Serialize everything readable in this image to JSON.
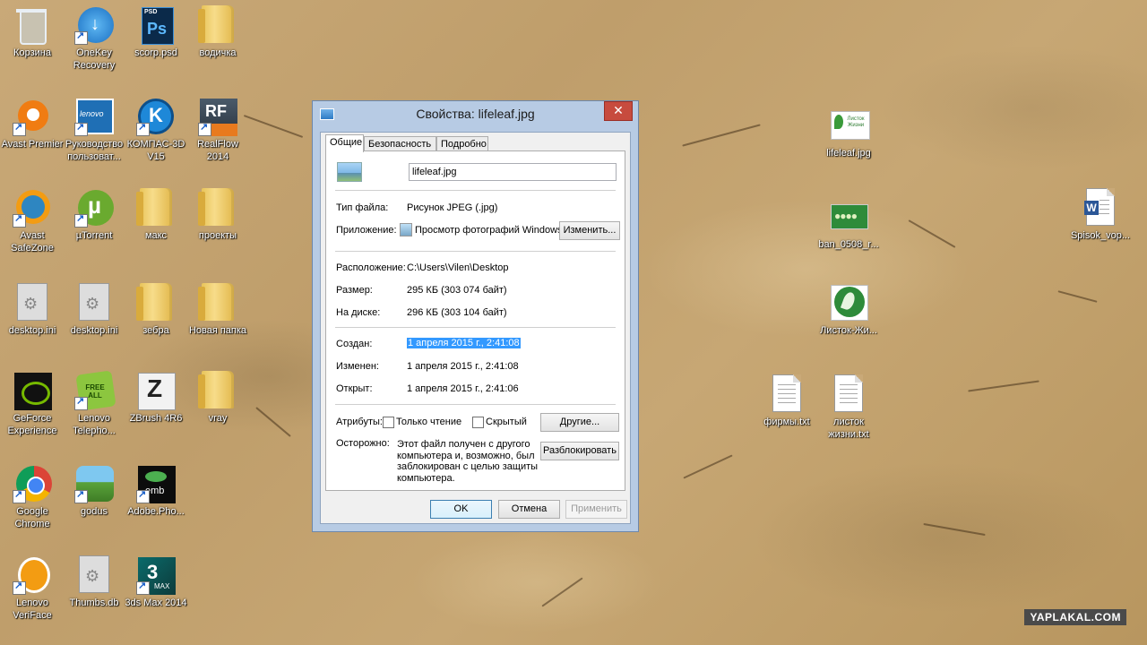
{
  "desktop": {
    "icons": [
      {
        "label": "Корзина",
        "icon": "recycle-bin-icon"
      },
      {
        "label": "OneKey Recovery",
        "icon": "onekey-recovery-icon"
      },
      {
        "label": "scorp.psd",
        "icon": "photoshop-file-icon",
        "badge": "PSD"
      },
      {
        "label": "водичка",
        "icon": "folder-icon"
      },
      {
        "label": "Avast Premier",
        "icon": "avast-icon"
      },
      {
        "label": "Руководство пользоват...",
        "icon": "lenovo-manual-icon",
        "badge": "lenovo"
      },
      {
        "label": "КОМПАС-3D V15",
        "icon": "kompas-icon"
      },
      {
        "label": "RealFlow 2014",
        "icon": "realflow-icon",
        "badge": "RF"
      },
      {
        "label": "Avast SafeZone",
        "icon": "avast-safezone-icon"
      },
      {
        "label": "µTorrent",
        "icon": "utorrent-icon"
      },
      {
        "label": "макс",
        "icon": "folder-icon"
      },
      {
        "label": "проекты",
        "icon": "folder-icon"
      },
      {
        "label": "desktop.ini",
        "icon": "settings-file-icon"
      },
      {
        "label": "desktop.ini",
        "icon": "settings-file-icon"
      },
      {
        "label": "зебра",
        "icon": "folder-icon"
      },
      {
        "label": "Новая папка",
        "icon": "folder-icon"
      },
      {
        "label": "GeForce Experience",
        "icon": "geforce-icon"
      },
      {
        "label": "Lenovo Telepho...",
        "icon": "lenovo-telephony-icon",
        "badge": "FREE ALL"
      },
      {
        "label": "ZBrush 4R6",
        "icon": "zbrush-icon"
      },
      {
        "label": "vray",
        "icon": "folder-icon"
      },
      {
        "label": "Google Chrome",
        "icon": "chrome-icon"
      },
      {
        "label": "godus",
        "icon": "godus-icon"
      },
      {
        "label": "Adobe.Pho...",
        "icon": "adobe-photoshop-icon",
        "badge": "emb"
      },
      {
        "label": "Lenovo VeriFace",
        "icon": "veriface-icon"
      },
      {
        "label": "Thumbs.db",
        "icon": "settings-file-icon"
      },
      {
        "label": "3ds Max 2014",
        "icon": "3dsmax-icon",
        "badge": "MAX"
      },
      {
        "label": "lifeleaf.jpg",
        "icon": "image-file-icon",
        "badge": "Листок Жизни"
      },
      {
        "label": "ban_0508_r...",
        "icon": "image-file-icon"
      },
      {
        "label": "Листок-Жи...",
        "icon": "image-file-icon"
      },
      {
        "label": "фирмы.txt",
        "icon": "text-file-icon"
      },
      {
        "label": "листок жизни.txt",
        "icon": "text-file-icon"
      },
      {
        "label": "Spisok_vop...",
        "icon": "word-file-icon",
        "badge": "W"
      }
    ]
  },
  "dialog": {
    "title": "Свойства: lifeleaf.jpg",
    "close_glyph": "✕",
    "tabs": [
      "Общие",
      "Безопасность",
      "Подробно"
    ],
    "active_tab": "Общие",
    "file_name": "lifeleaf.jpg",
    "type_label": "Тип файла:",
    "type_value": "Рисунок JPEG (.jpg)",
    "app_label": "Приложение:",
    "app_value": "Просмотр фотографий Windows",
    "change_button": "Изменить...",
    "location_label": "Расположение:",
    "location_value": "C:\\Users\\Vilen\\Desktop",
    "size_label": "Размер:",
    "size_value": "295 КБ (303 074 байт)",
    "disk_label": "На диске:",
    "disk_value": "296 КБ (303 104 байт)",
    "created_label": "Создан:",
    "created_value": "1 апреля 2015 г., 2:41:08",
    "modified_label": "Изменен:",
    "modified_value": "1 апреля 2015 г., 2:41:08",
    "opened_label": "Открыт:",
    "opened_value": "1 апреля 2015 г., 2:41:06",
    "attributes_label": "Атрибуты:",
    "readonly_label": "Только чтение",
    "readonly_checked": false,
    "hidden_label": "Скрытый",
    "hidden_checked": false,
    "other_button": "Другие...",
    "caution_label": "Осторожно:",
    "caution_lines": [
      "Этот файл получен с другого",
      "компьютера и, возможно, был",
      "заблокирован с целью защиты",
      "компьютера."
    ],
    "unblock_button": "Разблокировать",
    "ok_button": "OK",
    "cancel_button": "Отмена",
    "apply_button": "Применить"
  },
  "watermark": "YAPLAKAL.COM"
}
